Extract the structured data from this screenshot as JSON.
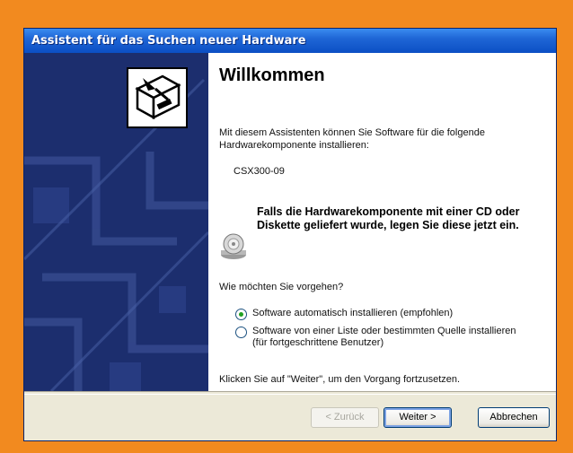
{
  "window": {
    "title": "Assistent für das Suchen neuer Hardware"
  },
  "content": {
    "heading": "Willkommen",
    "intro": "Mit diesem Assistenten können Sie Software für die folgende Hardwarekomponente installieren:",
    "device_name": "CSX300-09",
    "cd_notice": "Falls die Hardwarekomponente mit einer CD oder Diskette geliefert wurde, legen Sie diese jetzt ein.",
    "question": "Wie möchten Sie vorgehen?",
    "options": [
      {
        "label": "Software automatisch installieren (empfohlen)",
        "checked": true
      },
      {
        "label": "Software von einer Liste oder bestimmten Quelle installieren (für fortgeschrittene Benutzer)",
        "checked": false
      }
    ],
    "hint": "Klicken Sie auf \"Weiter\", um den Vorgang fortzusetzen."
  },
  "buttons": {
    "back": "< Zurück",
    "next": "Weiter >",
    "cancel": "Abbrechen"
  },
  "icons": {
    "hardware": "hardware-wizard-icon",
    "cd": "cd-drive-icon"
  },
  "colors": {
    "frame": "#f28a1f",
    "titlebar": "#1f66d6",
    "sidebar": "#1c2e6e"
  }
}
